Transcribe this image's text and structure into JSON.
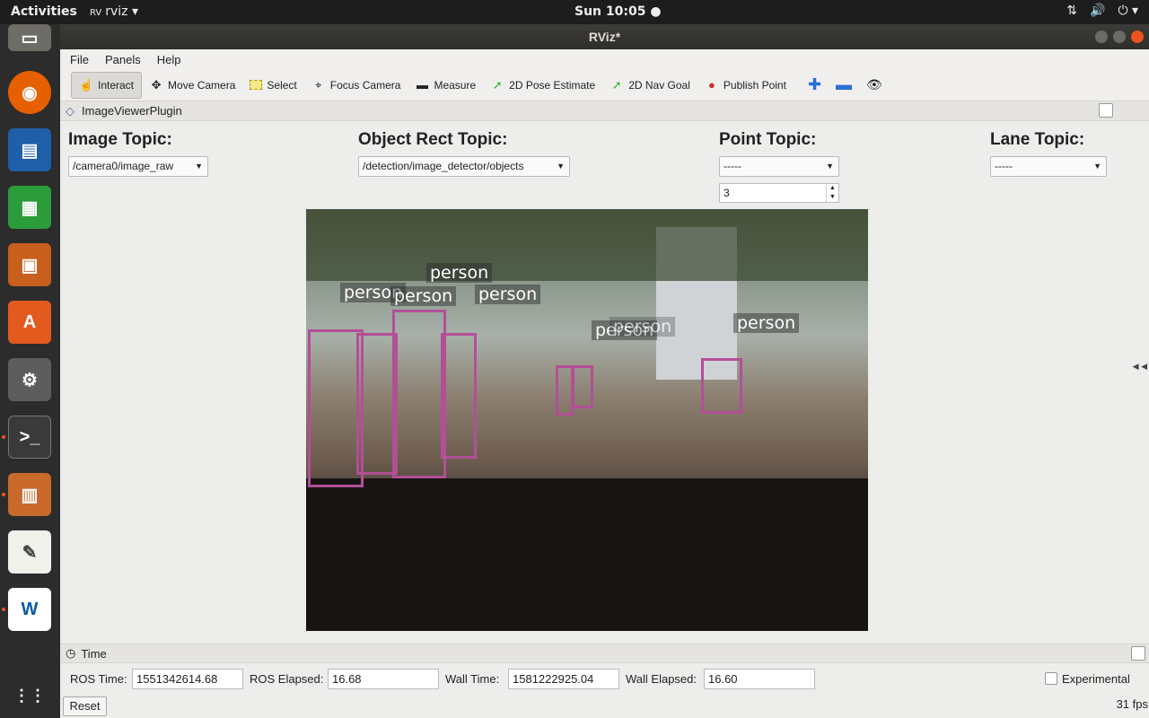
{
  "topbar": {
    "activities": "Activities",
    "app_menu": "rviz",
    "clock": "Sun 10:05 ●"
  },
  "window": {
    "title": "RViz*"
  },
  "menu": [
    "File",
    "Panels",
    "Help"
  ],
  "toolbar": [
    "Interact",
    "Move Camera",
    "Select",
    "Focus Camera",
    "Measure",
    "2D Pose Estimate",
    "2D Nav Goal",
    "Publish Point"
  ],
  "panel": {
    "title": "ImageViewerPlugin"
  },
  "topics": {
    "image_label": "Image Topic:",
    "image_value": "/camera0/image_raw",
    "rect_label": "Object Rect Topic:",
    "rect_value": "/detection/image_detector/objects",
    "point_label": "Point Topic:",
    "point_value": "-----",
    "point_size": "3",
    "lane_label": "Lane Topic:",
    "lane_value": "-----"
  },
  "detections": [
    "person",
    "person",
    "person",
    "person",
    "person",
    "person",
    "person"
  ],
  "time": {
    "title": "Time",
    "ros_time_label": "ROS Time:",
    "ros_time": "1551342614.68",
    "ros_elapsed_label": "ROS Elapsed:",
    "ros_elapsed": "16.68",
    "wall_time_label": "Wall Time:",
    "wall_time": "1581222925.04",
    "wall_elapsed_label": "Wall Elapsed:",
    "wall_elapsed": "16.60",
    "experimental": "Experimental",
    "reset": "Reset",
    "fps": "31 fps"
  },
  "colors": {
    "bbox": "#b24f97",
    "accent": "#e95420"
  }
}
